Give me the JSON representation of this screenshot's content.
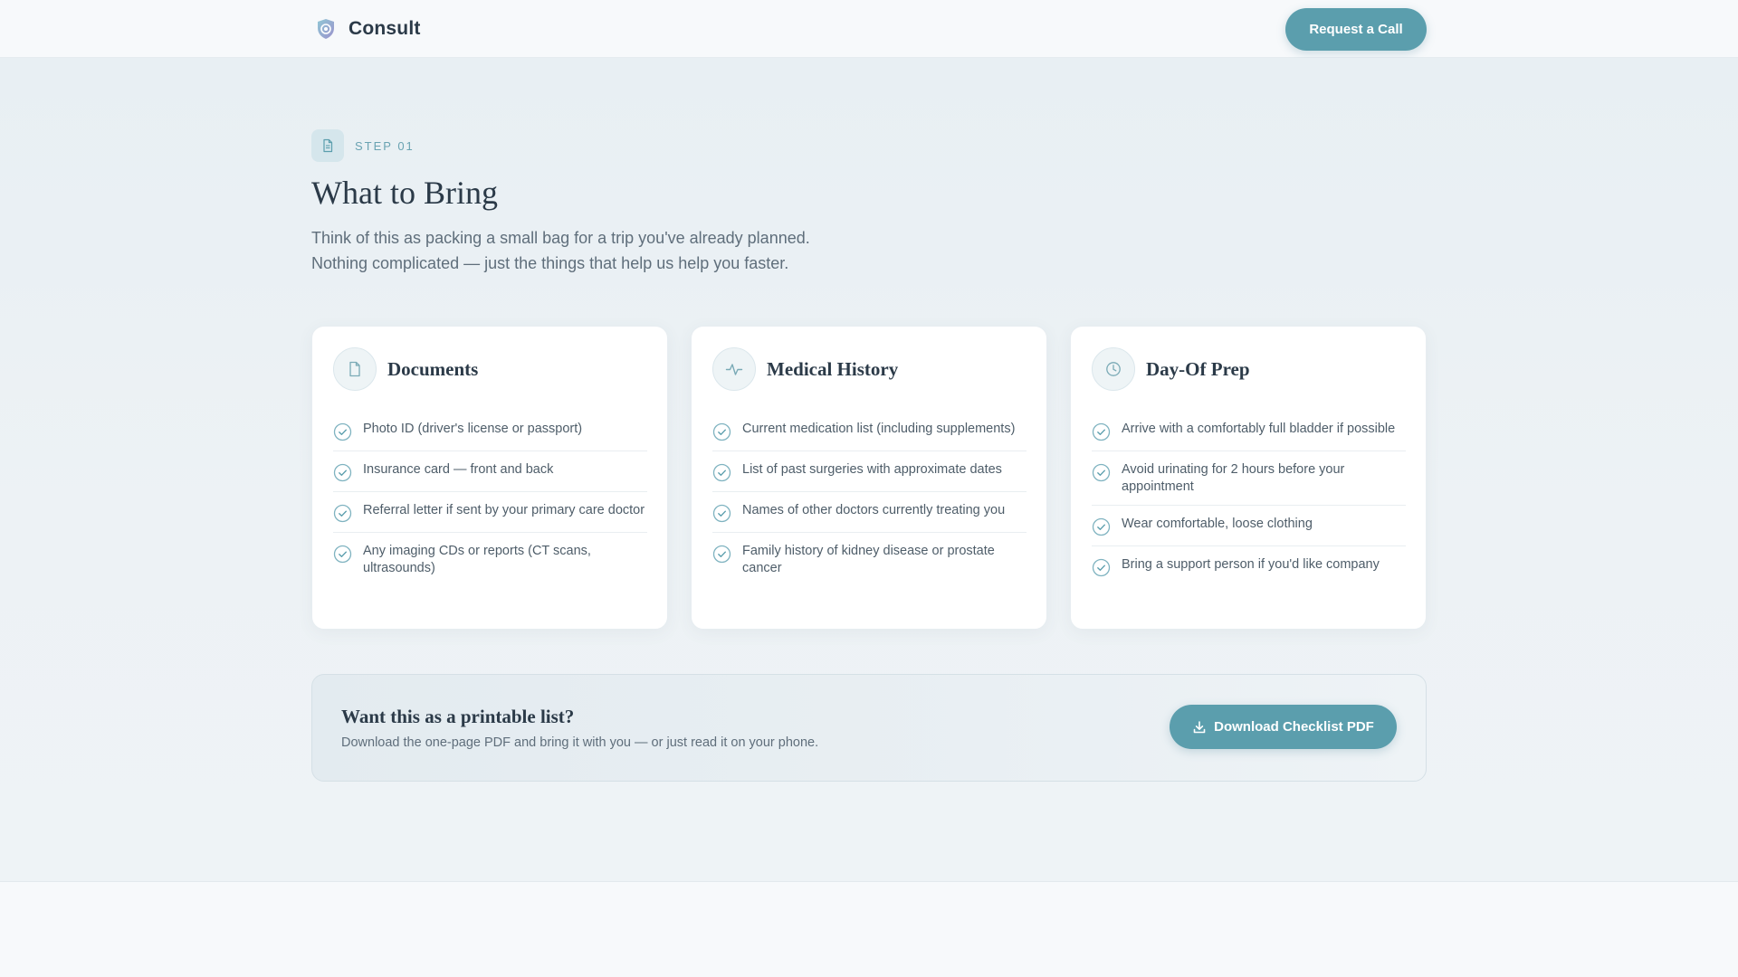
{
  "header": {
    "brand_name": "Consult",
    "logo_icon": "shield-logo-icon",
    "request_button": "Request a Call"
  },
  "step": {
    "icon": "document-icon",
    "label": "STEP 01"
  },
  "page": {
    "title": "What to Bring",
    "intro_line1": "Think of this as packing a small bag for a trip you've already planned.",
    "intro_line2": "Nothing complicated — just the things that help us help you faster."
  },
  "cards": [
    {
      "title": "Documents",
      "icon": "file-icon",
      "items": [
        "Photo ID (driver's license or passport)",
        "Insurance card — front and back",
        "Referral letter if sent by your primary care doctor",
        "Any imaging CDs or reports (CT scans, ultrasounds)"
      ]
    },
    {
      "title": "Medical History",
      "icon": "pulse-icon",
      "items": [
        "Current medication list (including supplements)",
        "List of past surgeries with approximate dates",
        "Names of other doctors currently treating you",
        "Family history of kidney disease or prostate cancer"
      ]
    },
    {
      "title": "Day-Of Prep",
      "icon": "clock-icon",
      "items": [
        "Arrive with a comfortably full bladder if possible",
        "Avoid urinating for 2 hours before your appointment",
        "Wear comfortable, loose clothing",
        "Bring a support person if you'd like company"
      ]
    }
  ],
  "cta": {
    "title": "Want this as a printable list?",
    "subtitle": "Download the one-page PDF and bring it with you — or just read it on your phone.",
    "button": "Download Checklist PDF",
    "button_icon": "download-icon"
  },
  "colors": {
    "accent": "#5b9ead",
    "text_dark": "#2b3a48",
    "text_muted": "#5f6e7b",
    "background": "#eaf0f4"
  }
}
